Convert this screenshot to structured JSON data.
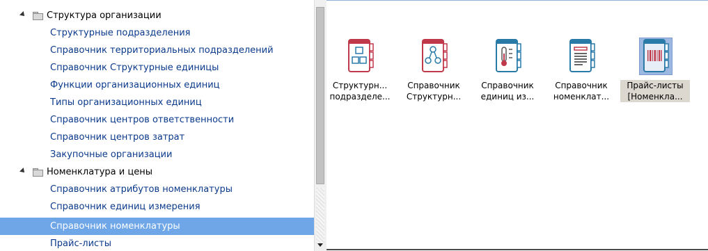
{
  "tree": {
    "groups": [
      {
        "label": "Структура организации",
        "items": [
          "Структурные подразделения",
          "Справочник территориальных подразделений",
          "Справочник Структурные единицы",
          "Функции организационных единиц",
          "Типы организационных единиц",
          "Справочник центров ответственности",
          "Справочник центров затрат",
          "Закупочные организации"
        ]
      },
      {
        "label": "Номенклатура и цены",
        "items": [
          "Справочник атрибутов номенклатуры",
          "Справочник единиц измерения",
          "Справочник номенклатуры",
          "Прайс-листы"
        ]
      }
    ],
    "selected_item": "Справочник номенклатуры"
  },
  "icons": [
    {
      "line1": "Структурн...",
      "line2": "подразделе...",
      "icon": "org-structure-icon",
      "color": "#c0394b"
    },
    {
      "line1": "Справочник",
      "line2": "Структурн...",
      "icon": "network-nodes-icon",
      "color": "#c0394b"
    },
    {
      "line1": "Справочник",
      "line2": "единиц из...",
      "icon": "thermometer-icon",
      "color": "#2a7aa8"
    },
    {
      "line1": "Справочник",
      "line2": "номенклат...",
      "icon": "document-list-icon",
      "color": "#2a7aa8"
    },
    {
      "line1": "Прайс-листы",
      "line2": "[Номенкла...",
      "icon": "barcode-icon",
      "color": "#c0394b",
      "selected": true
    }
  ]
}
